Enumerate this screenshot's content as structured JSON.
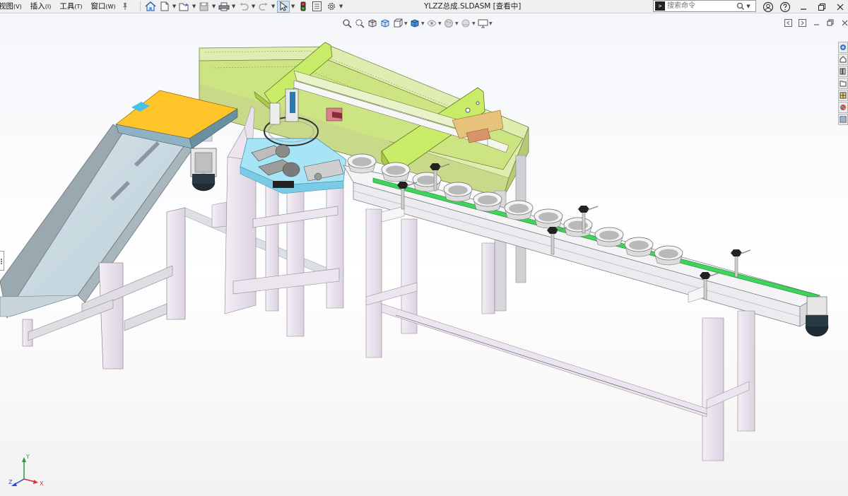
{
  "menu": {
    "items": [
      {
        "label": "视图",
        "accel": "(V)"
      },
      {
        "label": "插入",
        "accel": "(I)"
      },
      {
        "label": "工具",
        "accel": "(T)"
      },
      {
        "label": "窗口",
        "accel": "(W)"
      }
    ]
  },
  "toolbar": {
    "icons": [
      "home-icon",
      "new-document-icon",
      "open-icon",
      "save-icon",
      "print-icon",
      "undo-icon",
      "redo-icon",
      "select-icon",
      "traffic-light-icon",
      "options-panel-icon",
      "gear-icon"
    ]
  },
  "window": {
    "title": "YLZZ总成.SLDASM [查看中]"
  },
  "search": {
    "placeholder": "搜索命令"
  },
  "heads_up_toolbar": {
    "icons": [
      "zoom-to-fit-icon",
      "zoom-to-area-icon",
      "previous-view-icon",
      "section-view-icon",
      "view-orientation-icon",
      "display-style-icon",
      "hide-show-icon",
      "edit-appearance-icon",
      "apply-scene-icon",
      "view-settings-icon"
    ]
  },
  "task_pane": {
    "tabs": [
      "solidworks-resources-icon",
      "home-icon",
      "design-library-icon",
      "file-explorer-icon",
      "view-palette-icon",
      "appearances-icon",
      "custom-properties-icon"
    ]
  },
  "triad": {
    "labels": {
      "x": "X",
      "y": "Y",
      "z": "Z"
    }
  },
  "colors": {
    "frame": "#ece4ef",
    "conveyor_belt": "#cfdde5",
    "gantry": "#d6e8a0",
    "gantry_bright": "#c8ec68",
    "rail_green": "#3fd35c",
    "orange_pad": "#ffc42a",
    "cyan_plate": "#a6e4f6",
    "accent": "#2a6ebb"
  }
}
